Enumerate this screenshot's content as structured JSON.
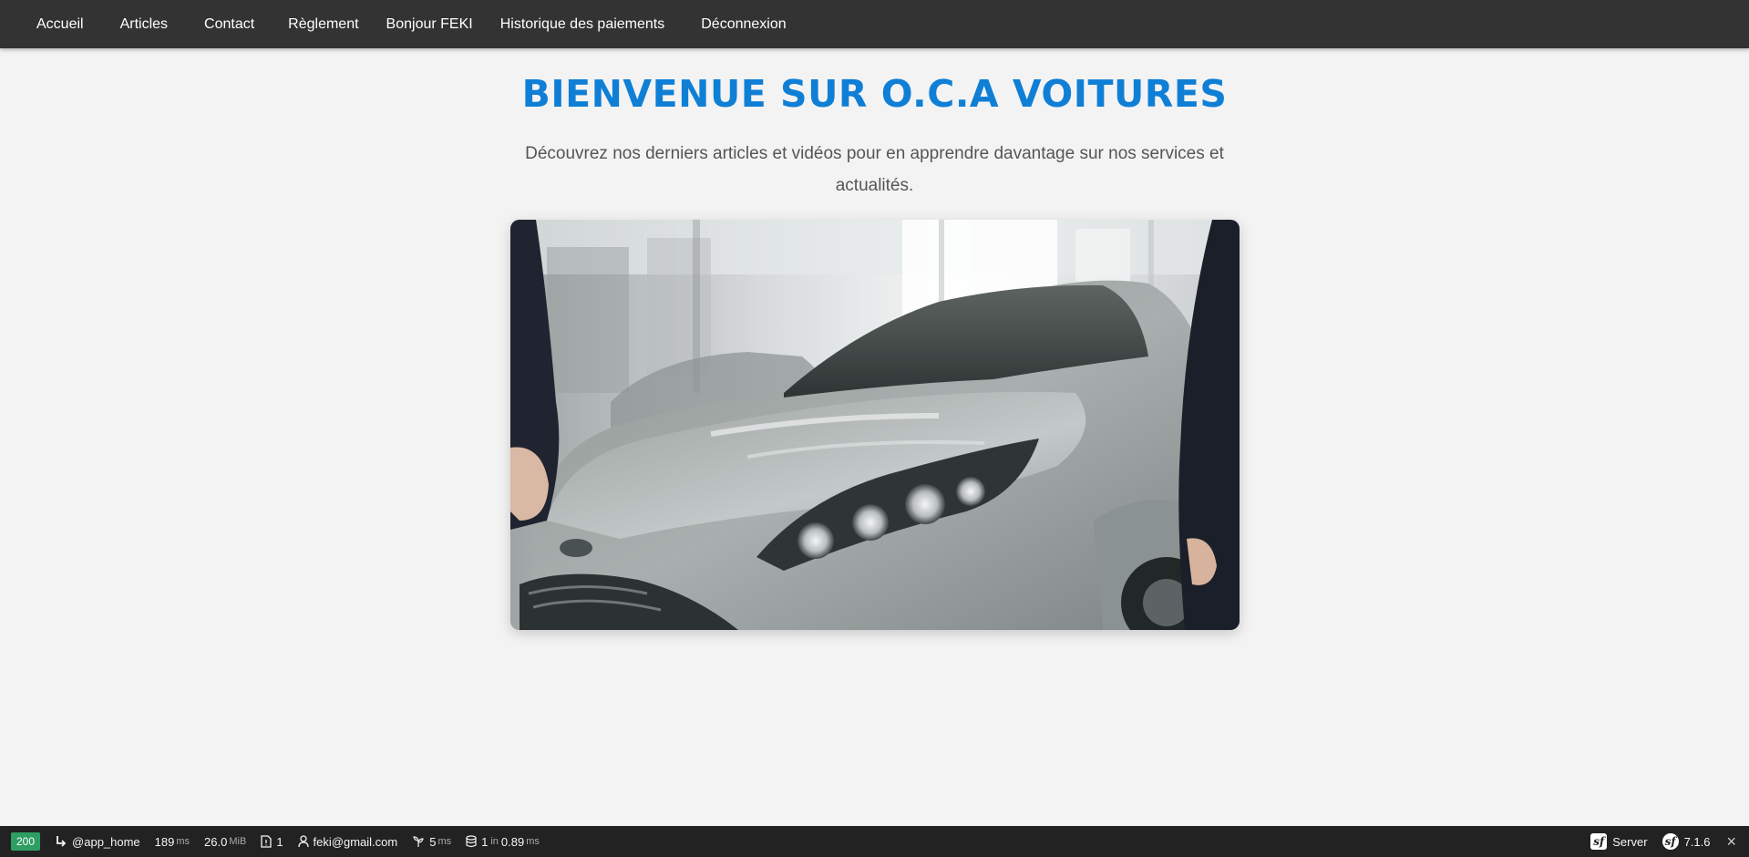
{
  "nav": {
    "home": "Accueil",
    "articles": "Articles",
    "contact": "Contact",
    "reglement": "Règlement",
    "greeting": "Bonjour FEKI",
    "history": "Historique des paiements",
    "logout": "Déconnexion"
  },
  "main": {
    "title": "BIENVENUE SUR O.C.A VOITURES",
    "intro": "Découvrez nos derniers articles et vidéos pour en apprendre davantage sur nos services et actualités."
  },
  "hero": {
    "icon": "car-photo"
  },
  "toolbar": {
    "status": "200",
    "route": "@app_home",
    "time_value": "189",
    "time_unit": "ms",
    "memory_value": "26.0",
    "memory_unit": "MiB",
    "logs_count": "1",
    "user": "feki@gmail.com",
    "twig_value": "5",
    "twig_unit": "ms",
    "db_queries": "1",
    "db_in": "in",
    "db_time": "0.89",
    "db_unit": "ms",
    "server_label": "Server",
    "version": "7.1.6",
    "close": "×"
  },
  "colors": {
    "nav_bg": "#333333",
    "title": "#0f7fd6",
    "page_bg": "#f3f3f3",
    "toolbar_bg": "#222222",
    "status_ok": "#2f9e62"
  }
}
